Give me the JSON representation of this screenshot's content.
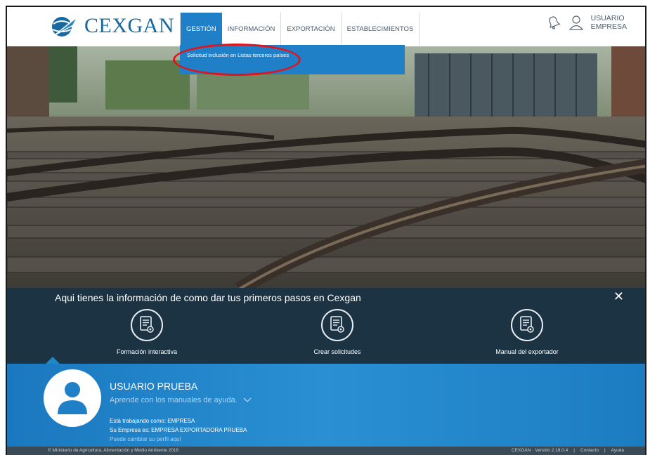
{
  "app": {
    "logo_text": "CEXGAN"
  },
  "nav": {
    "items": [
      {
        "label": "GESTIÓN"
      },
      {
        "label": "INFORMACIÓN"
      },
      {
        "label": "EXPORTACIÓN"
      },
      {
        "label": "ESTABLECIMIENTOS"
      }
    ],
    "active_index": 0
  },
  "dropdown": {
    "item": "Solicitud inclusión en Listas terceros países"
  },
  "user_menu": {
    "line1": "USUARIO",
    "line2": "EMPRESA"
  },
  "info": {
    "title": "Aqui tienes la información de como dar tus primeros pasos en Cexgan",
    "close": "✕",
    "cards": [
      {
        "label": "Formación interactiva",
        "icon": "certificate-icon"
      },
      {
        "label": "Crear solicitudes",
        "icon": "certificate-icon"
      },
      {
        "label": "Manual del exportador",
        "icon": "certificate-icon"
      }
    ]
  },
  "user_panel": {
    "name": "USUARIO PRUEBA",
    "help": "Aprende con los manuales de ayuda.",
    "working_as": "Está trabajando como: EMPRESA",
    "company": "Su Empresa es: EMPRESA EXPORTADORA PRUEBA",
    "change_profile": "Puede cambiar su perfil aquí"
  },
  "footer": {
    "copyright": "© Ministerio de Agricultura, Alimentación y Medio Ambiente 2016",
    "version": "CEXGAN · Versión 2.18.0.4",
    "contact": "Contacto",
    "help": "Ayuda"
  },
  "colors": {
    "brand": "#17699f",
    "nav_active": "#1f7fc7",
    "info_bar": "#1c3344",
    "user_panel": "#2a90d3",
    "highlight": "#e0141e"
  }
}
